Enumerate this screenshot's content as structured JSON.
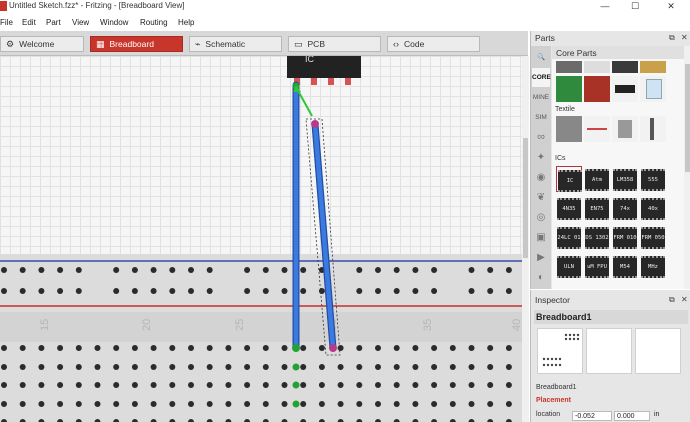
{
  "window": {
    "title": "Untitled Sketch.fzz* - Fritzing - [Breadboard View]",
    "minimize_glyph": "—",
    "maximize_glyph": "☐",
    "close_glyph": "✕"
  },
  "menu": [
    "File",
    "Edit",
    "Part",
    "View",
    "Window",
    "Routing",
    "Help"
  ],
  "tabs": [
    {
      "label": "Welcome",
      "icon": "gear-icon",
      "glyph": "⚙",
      "active": false
    },
    {
      "label": "Breadboard",
      "icon": "breadboard-icon",
      "glyph": "▦",
      "active": true
    },
    {
      "label": "Schematic",
      "icon": "schematic-icon",
      "glyph": "⌁",
      "active": false
    },
    {
      "label": "PCB",
      "icon": "pcb-icon",
      "glyph": "▭",
      "active": false
    },
    {
      "label": "Code",
      "icon": "code-icon",
      "glyph": "‹›",
      "active": false
    }
  ],
  "canvas": {
    "chip_label": "IC",
    "column_numbers": [
      "15",
      "20",
      "25",
      "30",
      "35",
      "40"
    ]
  },
  "parts": {
    "header": "Parts",
    "title": "Core Parts",
    "search_glyph": "🔍",
    "float_glyph": "⧉",
    "close_glyph": "✕",
    "bins": [
      "CORE",
      "MINE",
      "SIM"
    ],
    "textile_label": "Textile",
    "ics_label": "ICs",
    "ic_parts": [
      [
        "IC",
        "Atm",
        "LM358",
        "555"
      ],
      [
        "4N35",
        "EN75",
        "74x",
        "40x"
      ],
      [
        "24LC 01",
        "DS 1302",
        "FRM 010",
        "FRM 050"
      ],
      [
        "ULN 2003",
        "uM FPU",
        "M54",
        "MHz"
      ]
    ]
  },
  "inspector": {
    "header": "Inspector",
    "part_title": "Breadboard1",
    "part_name": "Breadboard1",
    "placement_label": "Placement",
    "location_label": "location",
    "location_x": "-0.052",
    "location_y": "0.000",
    "unit": "in",
    "float_glyph": "⧉",
    "close_glyph": "✕"
  },
  "colors": {
    "accent": "#c8352a",
    "wire": "#2f6fd4",
    "connected_green": "#22a335",
    "selected_end": "#b83a8c"
  }
}
